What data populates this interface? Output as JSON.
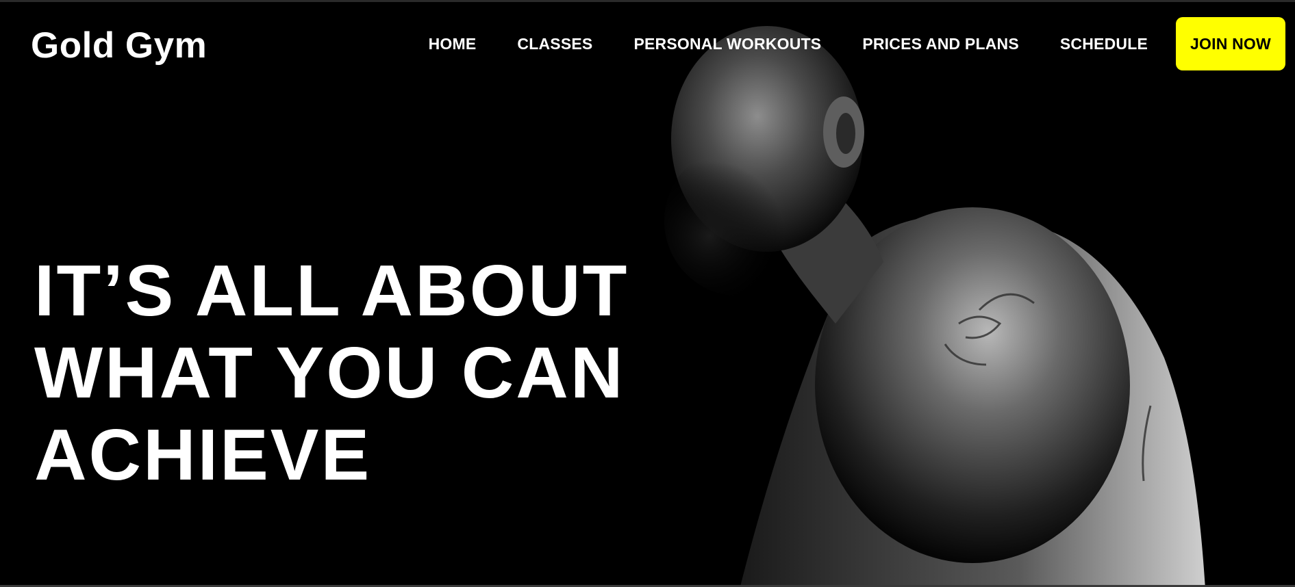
{
  "brand": {
    "logo_text": "Gold Gym"
  },
  "nav": {
    "items": [
      {
        "label": "HOME"
      },
      {
        "label": "CLASSES"
      },
      {
        "label": "PERSONAL WORKOUTS"
      },
      {
        "label": "PRICES AND PLANS"
      },
      {
        "label": "SCHEDULE"
      }
    ],
    "cta_label": "JOIN NOW"
  },
  "hero": {
    "headline_lines": [
      "IT’S ALL ABOUT",
      "WHAT YOU CAN",
      "ACHIEVE"
    ],
    "image_description_icon": "athlete-photo"
  },
  "colors": {
    "background": "#000000",
    "text": "#ffffff",
    "accent": "#ffff00"
  }
}
